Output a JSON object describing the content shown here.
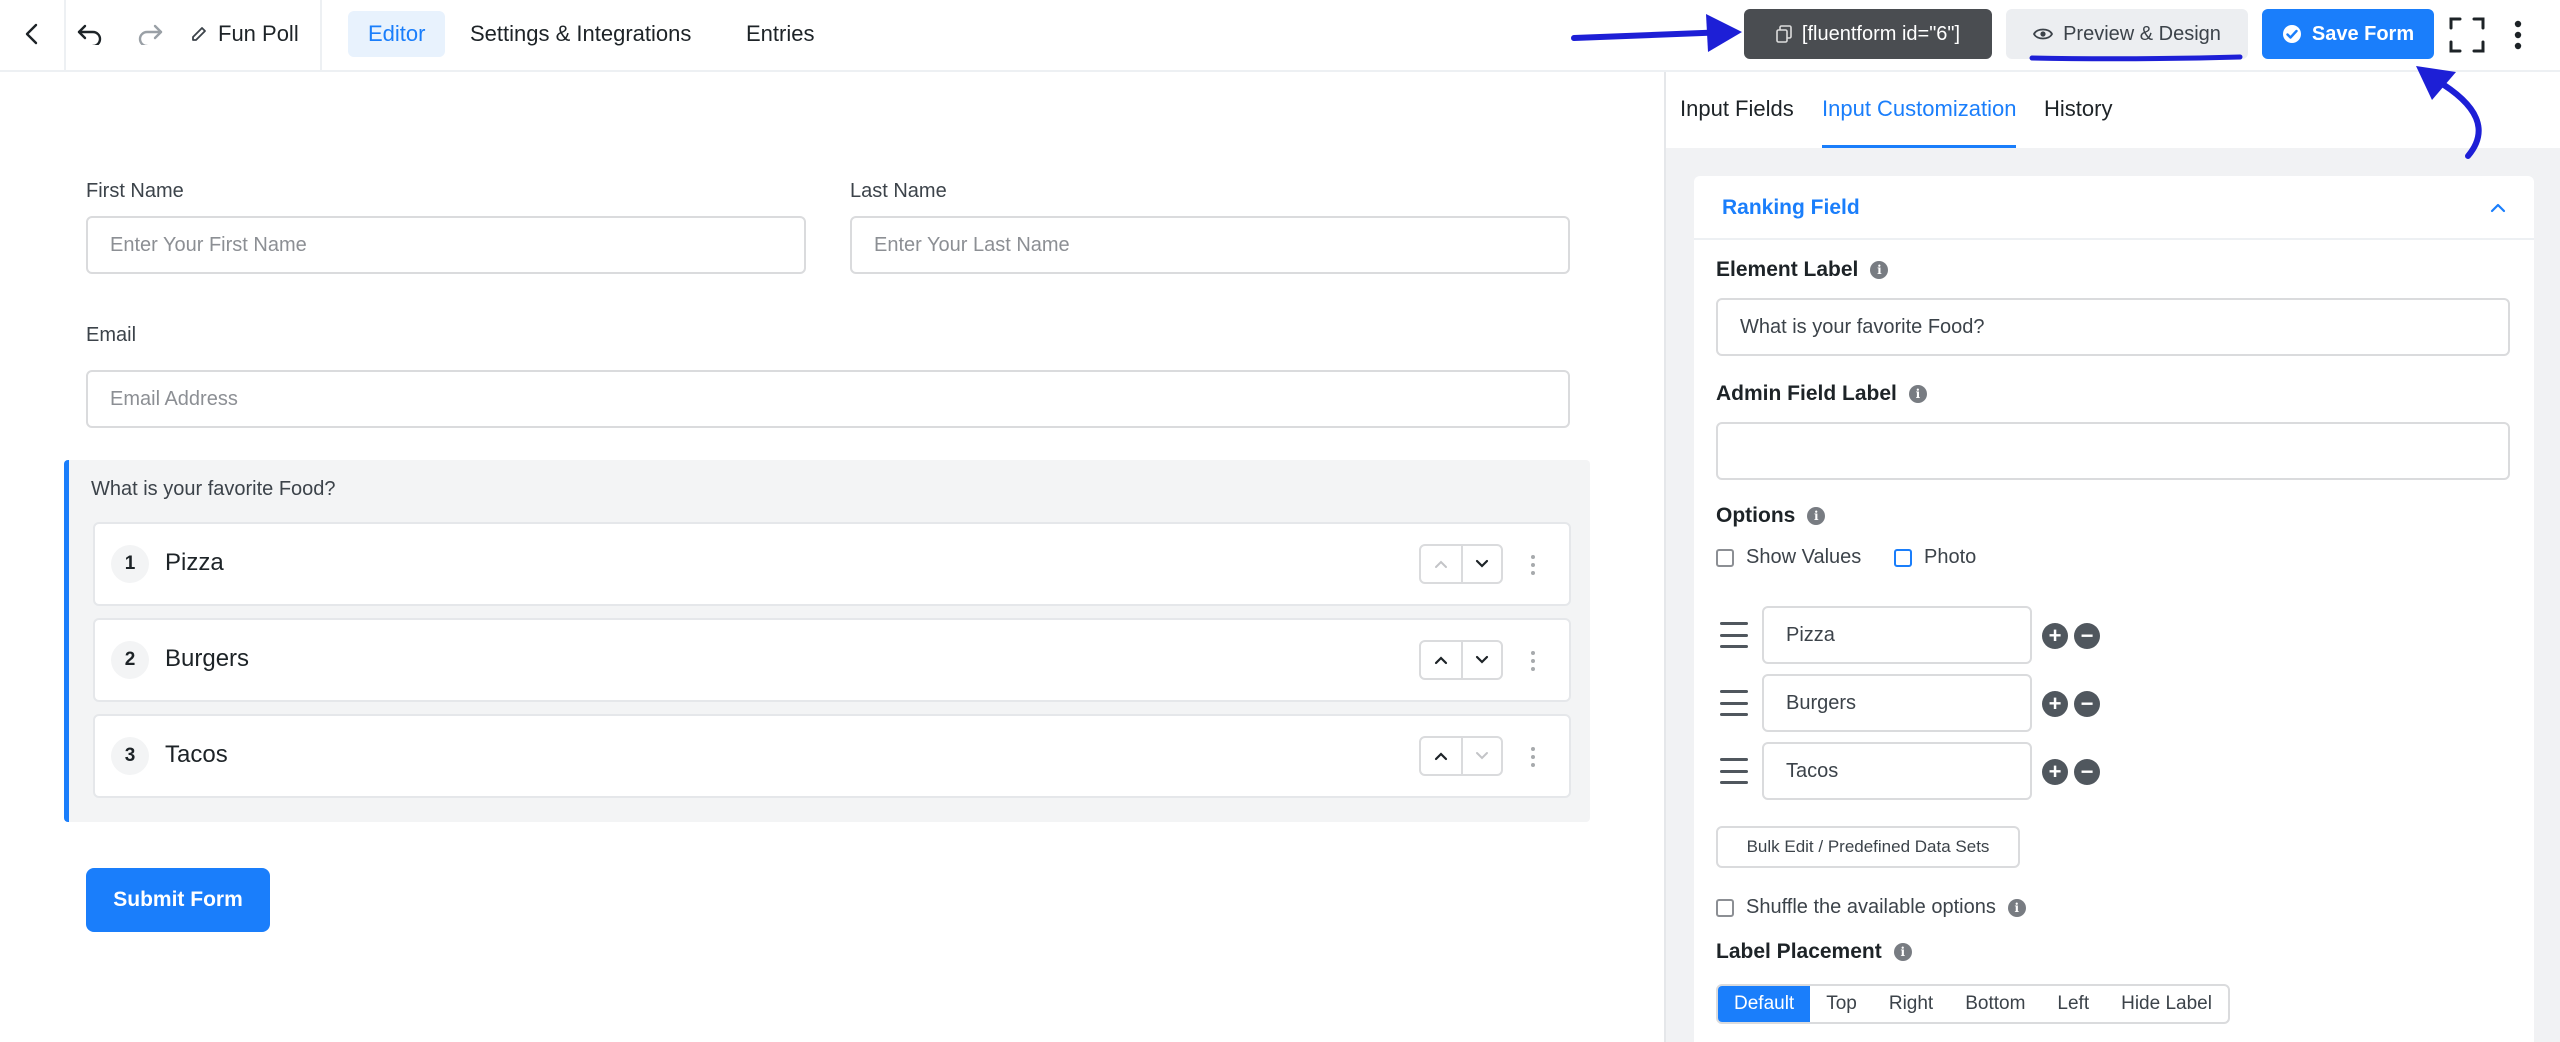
{
  "topbar": {
    "form_title": "Fun Poll",
    "tabs": [
      {
        "label": "Editor",
        "active": true
      },
      {
        "label": "Settings & Integrations",
        "active": false
      },
      {
        "label": "Entries",
        "active": false
      }
    ],
    "shortcode": "[fluentform id=\"6\"]",
    "preview_label": "Preview & Design",
    "save_label": "Save Form"
  },
  "form": {
    "first_name": {
      "label": "First Name",
      "placeholder": "Enter Your First Name"
    },
    "last_name": {
      "label": "Last Name",
      "placeholder": "Enter Your Last Name"
    },
    "email": {
      "label": "Email",
      "placeholder": "Email Address"
    },
    "ranking": {
      "question": "What is your favorite Food?",
      "items": [
        {
          "num": "1",
          "text": "Pizza"
        },
        {
          "num": "2",
          "text": "Burgers"
        },
        {
          "num": "3",
          "text": "Tacos"
        }
      ]
    },
    "submit_label": "Submit Form"
  },
  "sidebar": {
    "tabs": [
      {
        "label": "Input Fields",
        "active": false
      },
      {
        "label": "Input Customization",
        "active": true
      },
      {
        "label": "History",
        "active": false
      }
    ],
    "panel_title": "Ranking Field",
    "element_label": {
      "label": "Element Label",
      "value": "What is your favorite Food?"
    },
    "admin_label": {
      "label": "Admin Field Label",
      "value": ""
    },
    "options": {
      "label": "Options",
      "show_values": "Show Values",
      "photo": "Photo",
      "items": [
        "Pizza",
        "Burgers",
        "Tacos"
      ]
    },
    "bulk_edit": "Bulk Edit / Predefined Data Sets",
    "shuffle": "Shuffle the available options",
    "label_placement": {
      "label": "Label Placement",
      "options": [
        "Default",
        "Top",
        "Right",
        "Bottom",
        "Left",
        "Hide Label"
      ],
      "selected": "Default"
    }
  },
  "colors": {
    "accent": "#1a7efb",
    "annotation": "#1d1fd6",
    "shortcode_bg": "#4a4d51"
  }
}
